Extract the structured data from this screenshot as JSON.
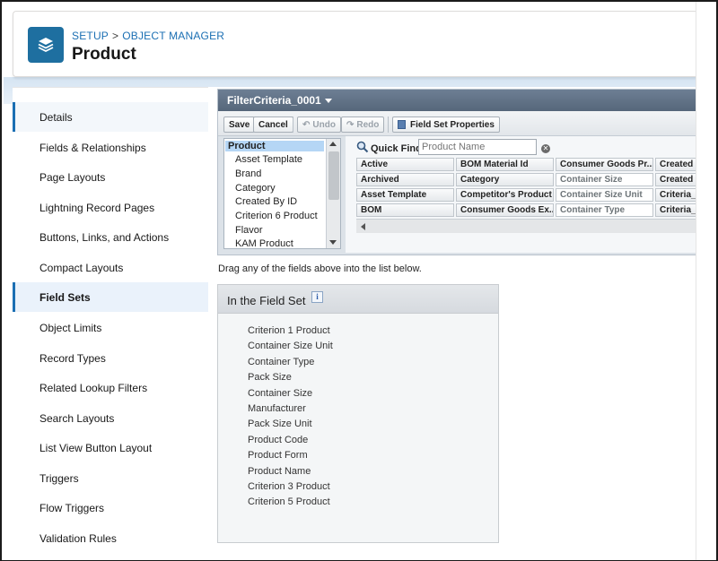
{
  "breadcrumb": {
    "setup": "SETUP",
    "separator": ">",
    "object_manager": "OBJECT MANAGER"
  },
  "page_title": "Product",
  "sidebar": {
    "items": [
      {
        "label": "Details",
        "state": "light"
      },
      {
        "label": "Fields & Relationships"
      },
      {
        "label": "Page Layouts"
      },
      {
        "label": "Lightning Record Pages"
      },
      {
        "label": "Buttons, Links, and Actions"
      },
      {
        "label": "Compact Layouts"
      },
      {
        "label": "Field Sets",
        "state": "active"
      },
      {
        "label": "Object Limits"
      },
      {
        "label": "Record Types"
      },
      {
        "label": "Related Lookup Filters"
      },
      {
        "label": "Search Layouts"
      },
      {
        "label": "List View Button Layout"
      },
      {
        "label": "Triggers"
      },
      {
        "label": "Flow Triggers"
      },
      {
        "label": "Validation Rules"
      }
    ]
  },
  "editor": {
    "title": "FilterCriteria_0001",
    "toolbar": {
      "save": "Save",
      "cancel": "Cancel",
      "undo": "Undo",
      "redo": "Redo",
      "properties": "Field Set Properties"
    },
    "objects": [
      "Product",
      "Asset Template",
      "Brand",
      "Category",
      "Created By ID",
      "Criterion 6 Product",
      "Flavor",
      "KAM Product"
    ],
    "quick_find": {
      "label": "Quick Find",
      "placeholder": "Product Name"
    },
    "fields": [
      [
        "Active",
        "BOM Material Id",
        "Consumer Goods Pr...",
        "Created By"
      ],
      [
        "Archived",
        "Category",
        "Container Size",
        "Created Da"
      ],
      [
        "Asset Template",
        "Competitor's Product",
        "Container Size Unit",
        "Criteria_Te"
      ],
      [
        "BOM",
        "Consumer Goods Ex...",
        "Container Type",
        "Criteria_Te"
      ]
    ],
    "dim_fields": [
      "Container Size",
      "Container Size Unit",
      "Container Type",
      "Criteria_Te"
    ]
  },
  "drag_hint": "Drag any of the fields above into the list below.",
  "field_set": {
    "title": "In the Field Set",
    "info_icon": "i",
    "items": [
      "Criterion 1 Product",
      "Container Size Unit",
      "Container Type",
      "Pack Size",
      "Container Size",
      "Manufacturer",
      "Pack Size Unit",
      "Product Code",
      "Product Form",
      "Product Name",
      "Criterion 3 Product",
      "Criterion 5 Product"
    ]
  },
  "colors": {
    "accent": "#1b6fb3",
    "header_icon": "#1e6fa0",
    "editor_title_bar": "#5f7186"
  }
}
